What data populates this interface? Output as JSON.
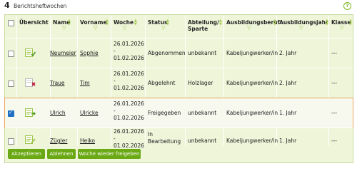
{
  "header": {
    "count": "4",
    "title": "Berichtsheftwochen",
    "help_icon": "?"
  },
  "columns": [
    {
      "label": "Übersicht"
    },
    {
      "label": "Name"
    },
    {
      "label": "Vorname"
    },
    {
      "label": "Woche"
    },
    {
      "label": "Status"
    },
    {
      "label": "Abteilung/\nSparte"
    },
    {
      "label": "Ausbildungsberuf"
    },
    {
      "label": "Ausbildungsjahr"
    },
    {
      "label": "Klasse"
    }
  ],
  "rows": [
    {
      "checked": false,
      "icon": "report-approved-icon",
      "name": "Neumeier",
      "vorname": "Sophie",
      "woche_start": "26.01.2026",
      "woche_sep": "-",
      "woche_end": "01.02.2026",
      "status": "Abgenommen",
      "abteilung": "unbekannt",
      "beruf": "Kabeljungwerker/in",
      "jahr": "2. Jahr",
      "klasse": "---"
    },
    {
      "checked": false,
      "icon": "report-rejected-icon",
      "name": "Traue",
      "vorname": "Tim",
      "woche_start": "26.01.2026",
      "woche_sep": "-",
      "woche_end": "01.02.2026",
      "status": "Abgelehnt",
      "abteilung": "Holzlager",
      "beruf": "Kabeljungwerker/in",
      "jahr": "2. Jahr",
      "klasse": "---"
    },
    {
      "checked": true,
      "icon": "report-released-icon",
      "name": "Ulrich",
      "vorname": "Ulricke",
      "woche_start": "26.01.2026",
      "woche_sep": "-",
      "woche_end": "01.02.2026",
      "status": "Freigegeben",
      "abteilung": "unbekannt",
      "beruf": "Kabeljungwerker/in",
      "jahr": "1. Jahr",
      "klasse": "---"
    },
    {
      "checked": false,
      "icon": "report-in-progress-icon",
      "name": "Zügler",
      "vorname": "Heiko",
      "woche_start": "26.01.2026",
      "woche_sep": "-",
      "woche_end": "01.02.2026",
      "status": "In\nBearbeitung",
      "abteilung": "unbekannt",
      "beruf": "Kabeljungwerker/in",
      "jahr": "1. Jahr",
      "klasse": "---"
    }
  ],
  "buttons": {
    "accept": "Akzeptieren",
    "reject": "Ablehnen",
    "release": "Woche wieder freigeben"
  },
  "colors": {
    "accent": "#6aa814",
    "selected_outline": "#f0a25a",
    "grid_bg": "#eef5d9"
  }
}
